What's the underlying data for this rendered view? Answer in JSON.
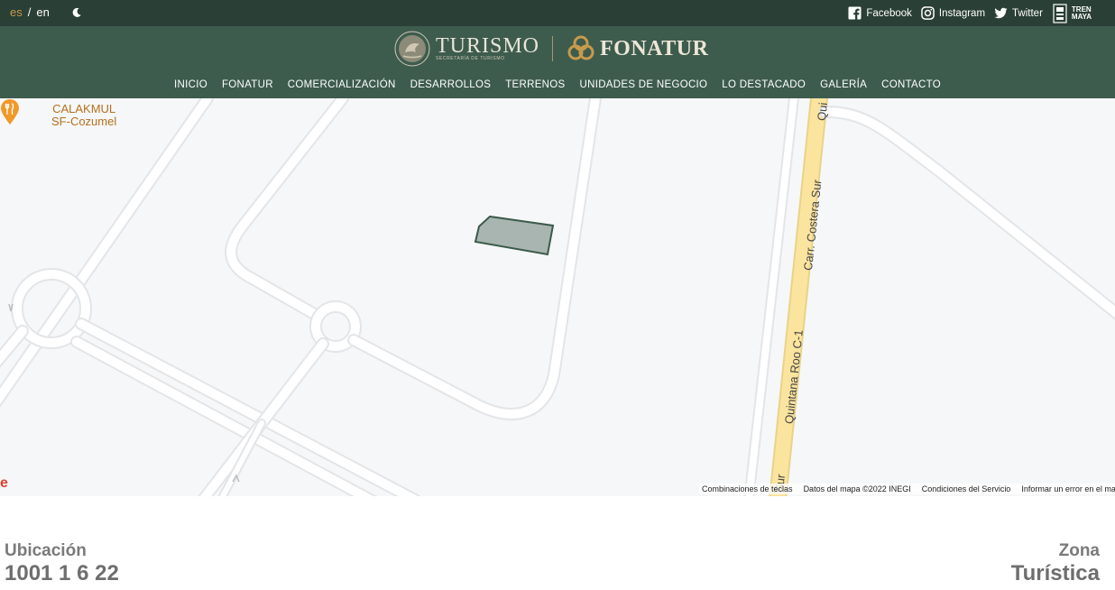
{
  "lang": {
    "es": "es",
    "sep": "/",
    "en": "en"
  },
  "social": {
    "facebook": "Facebook",
    "instagram": "Instagram",
    "twitter": "Twitter",
    "tren_line1": "TREN",
    "tren_line2": "MAYA"
  },
  "logo": {
    "turismo": "TURISMO",
    "turismo_sub": "SECRETARÍA DE TURISMO",
    "fonatur": "FONATUR"
  },
  "nav": [
    "INICIO",
    "FONATUR",
    "COMERCIALIZACIÓN",
    "DESARROLLOS",
    "TERRENOS",
    "UNIDADES DE NEGOCIO",
    "LO DESTACADO",
    "GALERÍA",
    "CONTACTO"
  ],
  "map": {
    "poi_line1": "CALAKMUL",
    "poi_line2": "SF-Cozumel",
    "road_main": "Carr. Costera Sur",
    "road_secondary": "Quintana Roo C-1",
    "road_top": "Qui",
    "road_bottom": "Sur",
    "google_fragment": "e",
    "attribution": {
      "shortcuts": "Combinaciones de teclas",
      "data": "Datos del mapa ©2022 INEGI",
      "terms": "Condiciones del Servicio",
      "report": "Informar un error en el mapa"
    }
  },
  "info": {
    "left_label": "Ubicación",
    "left_value": "1001 1 6 22",
    "right_label": "Zona",
    "right_value": "Turística"
  },
  "colors": {
    "topbar": "#2a3f35",
    "header": "#3d5c4e",
    "accent_gold": "#c89a4a",
    "parcel_fill": "#a9b5b0",
    "parcel_stroke": "#3a5a4a",
    "highway": "#fbe49e"
  }
}
